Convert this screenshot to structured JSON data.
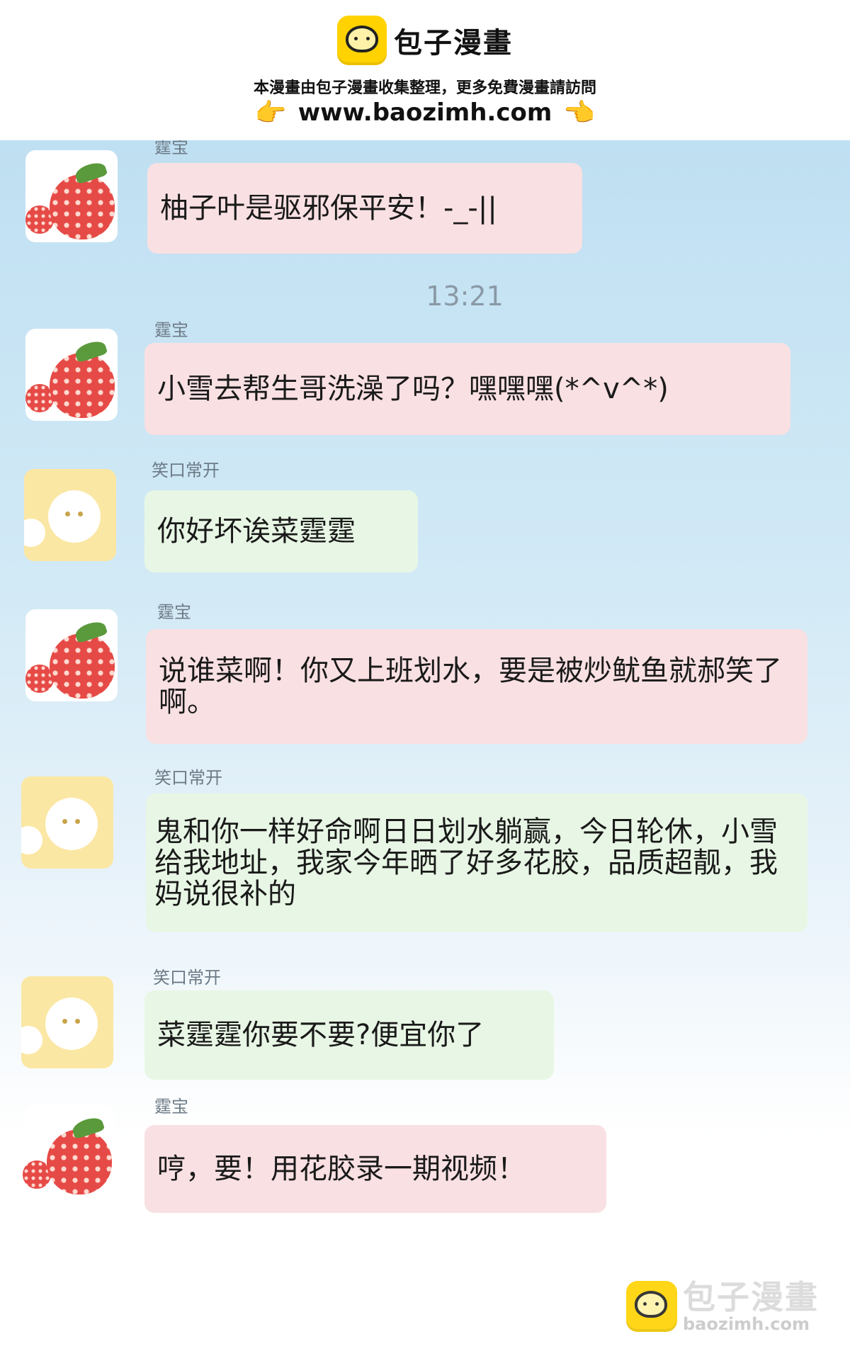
{
  "banner": {
    "brand": "包子漫畫",
    "notice": "本漫畫由包子漫畫收集整理，更多免費漫畫請訪問",
    "url": "www.baozimh.com",
    "hand_left": "👉",
    "hand_right": "👈"
  },
  "chat": {
    "top_sender_partial": "霆宝",
    "timestamp": "13:21",
    "messages": [
      {
        "sender": "霆宝",
        "text": "柚子叶是驱邪保平安！-_-||",
        "avatar": "strawberry-avatar"
      },
      {
        "sender": "霆宝",
        "text": "小雪去帮生哥洗澡了吗？嘿嘿嘿(*^v^*)",
        "avatar": "strawberry-avatar"
      },
      {
        "sender": "笑口常开",
        "text": "你好坏诶菜霆霆",
        "avatar": "bun-avatar"
      },
      {
        "sender": "霆宝",
        "text": "说谁菜啊！你又上班划水，要是被炒鱿鱼就郝笑了啊。",
        "avatar": "strawberry-avatar"
      },
      {
        "sender": "笑口常开",
        "text": "鬼和你一样好命啊日日划水躺赢，今日轮休，小雪给我地址，我家今年晒了好多花胶，品质超靓，我妈说很补的",
        "avatar": "bun-avatar"
      },
      {
        "sender": "笑口常开",
        "text": "菜霆霆你要不要?便宜你了",
        "avatar": "bun-avatar"
      },
      {
        "sender": "霆宝",
        "text": "哼，要！用花胶录一期视频！",
        "avatar": "strawberry-avatar"
      }
    ]
  },
  "watermark": {
    "brand": "包子漫畫",
    "url": "baozimh.com"
  }
}
